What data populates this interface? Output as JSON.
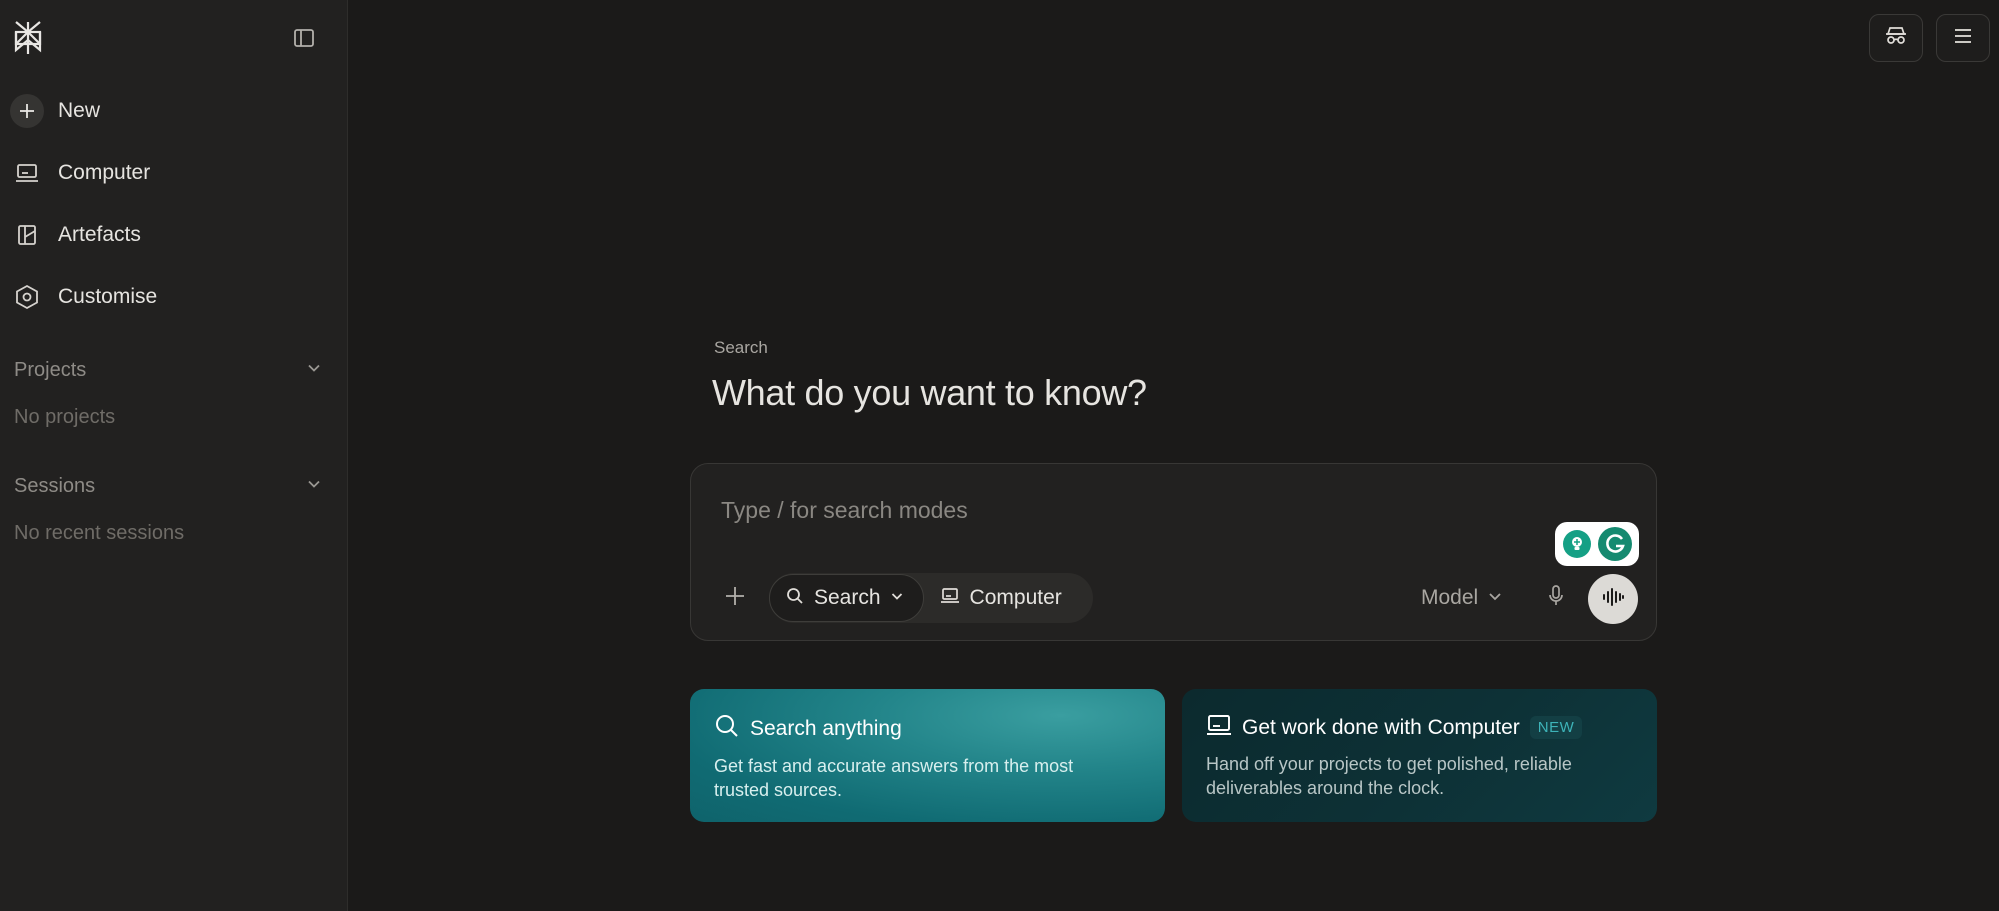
{
  "sidebar": {
    "logo_icon": "perplexity-logo-icon",
    "collapse_icon": "sidebar-toggle-icon",
    "nav": [
      {
        "label": "New",
        "icon": "plus-icon"
      },
      {
        "label": "Computer",
        "icon": "computer-icon"
      },
      {
        "label": "Artefacts",
        "icon": "artefacts-icon"
      },
      {
        "label": "Customise",
        "icon": "hexagon-settings-icon"
      }
    ],
    "sections": [
      {
        "label": "Projects",
        "empty": "No projects"
      },
      {
        "label": "Sessions",
        "empty": "No recent sessions"
      }
    ]
  },
  "topbar": {
    "incognito_icon": "incognito-icon",
    "menu_icon": "menu-icon"
  },
  "main": {
    "kicker": "Search",
    "headline": "What do you want to know?",
    "prompt": {
      "placeholder": "Type / for search modes",
      "value": "",
      "modes": [
        {
          "label": "Search",
          "icon": "search-icon"
        },
        {
          "label": "Computer",
          "icon": "computer-icon"
        }
      ],
      "model_label": "Model"
    },
    "cards": [
      {
        "title": "Search anything",
        "description": "Get fast and accurate answers from the most trusted sources."
      },
      {
        "title": "Get work done with Computer",
        "badge": "NEW",
        "description": "Hand off your projects to get polished, reliable deliverables around the clock."
      }
    ]
  },
  "colors": {
    "background": "#1b1a19",
    "sidebar": "#222120",
    "accent_teal": "#20808d",
    "grammarly_green": "#15a085"
  }
}
